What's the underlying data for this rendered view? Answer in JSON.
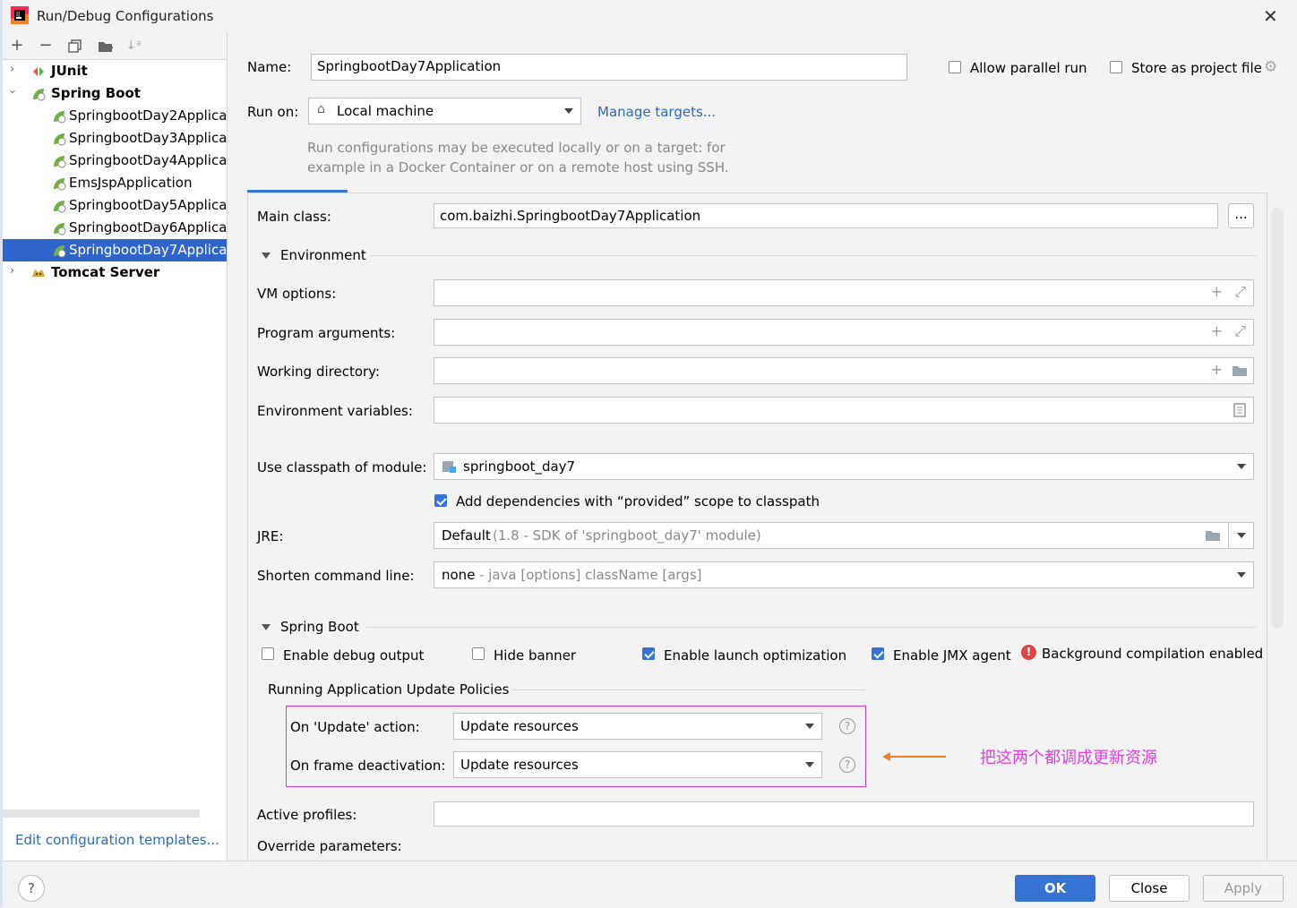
{
  "window": {
    "title": "Run/Debug Configurations"
  },
  "tree": {
    "items": [
      {
        "label": "JUnit",
        "bold": true
      },
      {
        "label": "Spring Boot",
        "bold": true
      },
      {
        "label": "SpringbootDay2Applica"
      },
      {
        "label": "SpringbootDay3Applica"
      },
      {
        "label": "SpringbootDay4Applica"
      },
      {
        "label": "EmsJspApplication"
      },
      {
        "label": "SpringbootDay5Applica"
      },
      {
        "label": "SpringbootDay6Applica"
      },
      {
        "label": "SpringbootDay7Applica",
        "selected": true
      },
      {
        "label": "Tomcat Server",
        "bold": true
      }
    ],
    "edit_templates": "Edit configuration templates..."
  },
  "header": {
    "name_label": "Name:",
    "name_value": "SpringbootDay7Application",
    "allow_parallel": "Allow parallel run",
    "store_project": "Store as project file",
    "run_on_label": "Run on:",
    "run_on_value": "Local machine",
    "manage_targets": "Manage targets...",
    "hint_line1": "Run configurations may be executed locally or on a target: for",
    "hint_line2": "example in a Docker Container or on a remote host using SSH."
  },
  "form": {
    "main_class_label": "Main class:",
    "main_class_value": "com.baizhi.SpringbootDay7Application",
    "browse": "...",
    "environment_header": "Environment",
    "vm_options": "VM options:",
    "program_args": "Program arguments:",
    "working_dir": "Working directory:",
    "env_vars": "Environment variables:",
    "classpath_label": "Use classpath of module:",
    "classpath_value": "springboot_day7",
    "add_deps": "Add dependencies with “provided” scope to classpath",
    "jre_label": "JRE:",
    "jre_value": "Default",
    "jre_hint": "(1.8 - SDK of 'springboot_day7' module)",
    "shorten_label": "Shorten command line:",
    "shorten_value": "none",
    "shorten_hint": "- java [options] className [args]",
    "springboot_header": "Spring Boot",
    "enable_debug": "Enable debug output",
    "hide_banner": "Hide banner",
    "launch_opt": "Enable launch optimization",
    "jmx_agent": "Enable JMX agent",
    "bg_compile": "Background compilation enabled",
    "update_policies": "Running Application Update Policies",
    "on_update_label": "On 'Update' action:",
    "on_update_value": "Update resources",
    "on_frame_label": "On frame deactivation:",
    "on_frame_value": "Update resources",
    "active_profiles": "Active profiles:",
    "override_params": "Override parameters:"
  },
  "annotation": "把这两个都调成更新资源",
  "buttons": {
    "ok": "OK",
    "close": "Close",
    "apply": "Apply",
    "help": "?"
  },
  "colors": {
    "accent": "#3574d4",
    "selection": "#2f65ca",
    "annotation": "#e040e0",
    "link": "#2a6bbd"
  }
}
